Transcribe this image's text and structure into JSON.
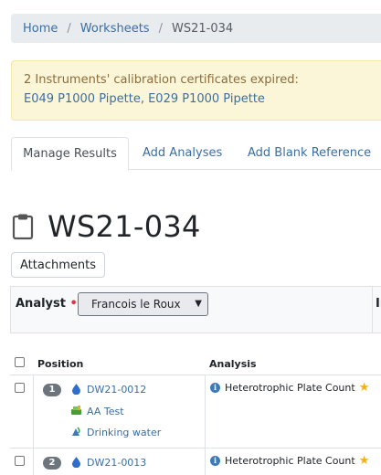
{
  "breadcrumb": {
    "home": "Home",
    "sep": "/",
    "worksheets": "Worksheets",
    "current": "WS21-034"
  },
  "alert": {
    "message": "2 Instruments' calibration certificates expired:",
    "links": "E049 P1000 Pipette, E029 P1000 Pipette"
  },
  "tabs": [
    {
      "label": "Manage Results",
      "active": true
    },
    {
      "label": "Add Analyses"
    },
    {
      "label": "Add Blank Reference"
    }
  ],
  "page": {
    "title": "WS21-034",
    "title_icon": "clipboard-icon"
  },
  "buttons": {
    "attachments": "Attachments"
  },
  "analyst": {
    "label": "Analyst",
    "required_mark": "•",
    "selected": "Francois le Roux",
    "next_column_label": "In"
  },
  "table": {
    "headers": {
      "position": "Position",
      "analysis": "Analysis"
    },
    "rows": [
      {
        "position": "1",
        "sample": "DW21-0012",
        "sample_type": "AA Test",
        "sample_point": "Drinking water",
        "analysis": "Heterotrophic Plate Count"
      },
      {
        "position": "2",
        "sample": "DW21-0013",
        "analysis": "Heterotrophic Plate Count"
      }
    ]
  },
  "colors": {
    "link": "#3a6ea5",
    "alert_bg": "#fcf6d9",
    "alert_text": "#8a6d3b",
    "badge": "#6c757d",
    "required": "#dc3545"
  }
}
